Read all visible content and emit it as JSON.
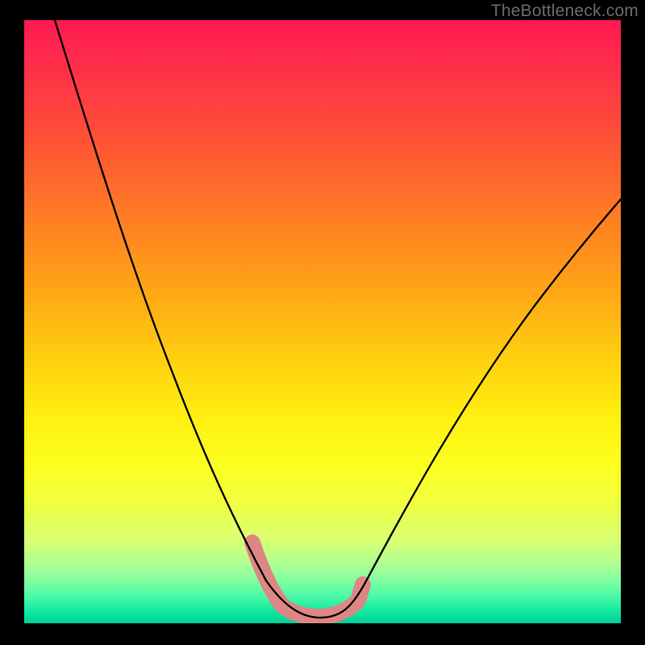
{
  "watermark": "TheBottleneck.com",
  "chart_data": {
    "type": "line",
    "title": "",
    "xlabel": "",
    "ylabel": "",
    "xlim": [
      0,
      100
    ],
    "ylim": [
      0,
      100
    ],
    "series": [
      {
        "name": "bottleneck-curve",
        "x": [
          0,
          6,
          12,
          18,
          22,
          26,
          30,
          33.5,
          36.5,
          39.5,
          42,
          45,
          48,
          52,
          56,
          60,
          65,
          72,
          80,
          88,
          96,
          100
        ],
        "values": [
          100,
          88,
          76,
          65,
          57,
          50,
          42,
          33,
          23,
          13,
          6,
          1.5,
          1,
          1.3,
          4,
          10,
          20,
          32,
          44,
          54,
          62,
          65
        ]
      }
    ],
    "annotations": [
      {
        "name": "highlight-segment",
        "type": "range-along-curve",
        "x_start": 38,
        "x_end": 56,
        "color": "#e08080",
        "stroke_width_px": 18
      }
    ],
    "background_gradient": {
      "top": "#ff1a52",
      "middle": "#ffe010",
      "bottom": "#00d098"
    }
  }
}
